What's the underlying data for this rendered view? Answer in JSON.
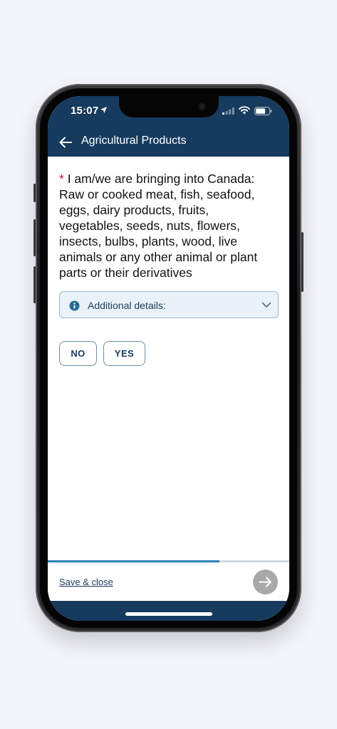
{
  "status_bar": {
    "time": "15:07",
    "icons": [
      "location-arrow-icon",
      "signal-icon",
      "wifi-icon",
      "battery-icon"
    ]
  },
  "app_bar": {
    "title": "Agricultural Products",
    "back_icon": "arrow-left-icon"
  },
  "question": {
    "required_marker": "*",
    "text": "I am/we are bringing into Canada: Raw or cooked meat, fish, seafood, eggs, dairy products, fruits, vegetables, seeds, nuts, flowers, insects, bulbs, plants, wood, live animals or any other animal or plant parts or their derivatives"
  },
  "details": {
    "label": "Additional details:",
    "icon": "info-icon",
    "expand_icon": "chevron-down-icon"
  },
  "choices": {
    "no_label": "NO",
    "yes_label": "YES"
  },
  "progress": {
    "fraction": 0.71
  },
  "footer": {
    "save_label": "Save & close",
    "next_icon": "arrow-right-icon"
  },
  "colors": {
    "header_bg": "#173b5e",
    "required": "#c8102e",
    "progress_fill": "#2f82b8",
    "accordion_bg": "#e9f2f8",
    "next_button_disabled": "#a9a9a9"
  }
}
